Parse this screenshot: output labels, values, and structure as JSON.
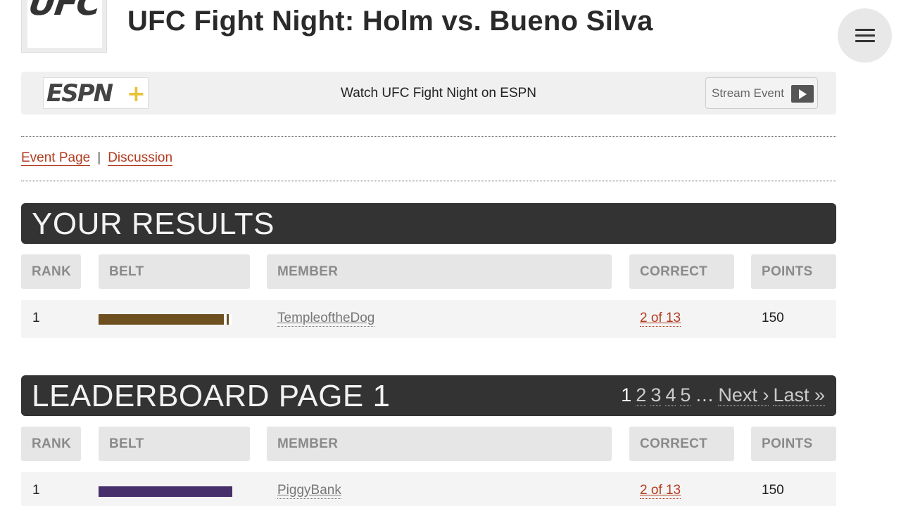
{
  "header": {
    "logo_text": "UFC",
    "title": "UFC Fight Night: Holm vs. Bueno Silva",
    "menu_icon": "hamburger-menu-icon"
  },
  "espn": {
    "logo_text": "ESPN+",
    "watch_text": "Watch UFC Fight Night on ESPN",
    "stream_label": "Stream Event",
    "stream_icon": "play-icon"
  },
  "nav": {
    "event_page": "Event Page",
    "separator": "|",
    "discussion": "Discussion"
  },
  "your_results": {
    "title": "YOUR RESULTS",
    "columns": [
      "RANK",
      "BELT",
      "MEMBER",
      "CORRECT",
      "POINTS"
    ],
    "rows": [
      {
        "rank": "1",
        "belt_color": "#6e5020",
        "member": "TempleoftheDog",
        "correct": "2 of 13",
        "points": "150"
      }
    ]
  },
  "leaderboard": {
    "title": "LEADERBOARD PAGE 1",
    "pagination": {
      "current": "1",
      "pages": [
        "2",
        "3",
        "4",
        "5"
      ],
      "ellipsis": "…",
      "next": "Next ›",
      "last": "Last »"
    },
    "columns": [
      "RANK",
      "BELT",
      "MEMBER",
      "CORRECT",
      "POINTS"
    ],
    "rows": [
      {
        "rank": "1",
        "belt_color": "#472f6b",
        "member": "PiggyBank",
        "correct": "2 of 13",
        "points": "150"
      }
    ]
  },
  "colors": {
    "accent_link": "#b23a1e",
    "header_dark": "#333333",
    "espn_plus_yellow": "#e8c23a"
  }
}
